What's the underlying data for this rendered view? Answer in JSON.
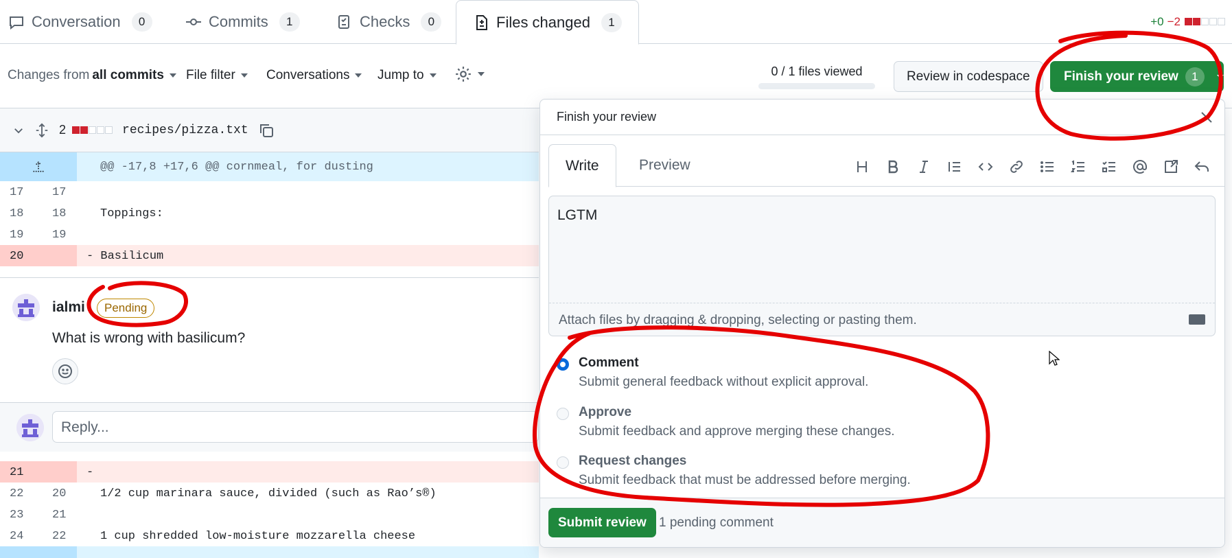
{
  "tabs": [
    {
      "label": "Conversation",
      "count": "0"
    },
    {
      "label": "Commits",
      "count": "1"
    },
    {
      "label": "Checks",
      "count": "0"
    },
    {
      "label": "Files changed",
      "count": "1"
    }
  ],
  "diffstat": {
    "additions": "+0",
    "deletions": "−2"
  },
  "toolbar": {
    "changes_from_prefix": "Changes from",
    "changes_from_value": "all commits",
    "file_filter": "File filter",
    "conversations": "Conversations",
    "jump_to": "Jump to",
    "files_viewed": "0 / 1 files viewed",
    "review_codespace": "Review in codespace",
    "finish_review": "Finish your review",
    "finish_count": "1"
  },
  "file": {
    "changes_count": "2",
    "path": "recipes/pizza.txt",
    "hunk": "@@ -17,8 +17,6 @@ cornmeal, for dusting"
  },
  "lines_top": [
    {
      "old": "17",
      "new": "17",
      "code": ""
    },
    {
      "old": "18",
      "new": "18",
      "code": "Toppings:"
    },
    {
      "old": "19",
      "new": "19",
      "code": ""
    },
    {
      "old": "20",
      "new": "",
      "code": "- Basilicum",
      "type": "del"
    }
  ],
  "comment": {
    "author": "ialmi",
    "badge": "Pending",
    "text": "What is wrong with basilicum?",
    "reply_placeholder": "Reply..."
  },
  "lines_bottom": [
    {
      "old": "21",
      "new": "",
      "code": "-",
      "type": "del"
    },
    {
      "old": "22",
      "new": "20",
      "code": "1/2 cup marinara sauce, divided (such as Rao’s®)"
    },
    {
      "old": "23",
      "new": "21",
      "code": ""
    },
    {
      "old": "24",
      "new": "22",
      "code": "1 cup shredded low-moisture mozzarella cheese"
    }
  ],
  "panel": {
    "title": "Finish your review",
    "tab_write": "Write",
    "tab_preview": "Preview",
    "body": "LGTM",
    "attach": "Attach files by dragging & dropping, selecting or pasting them.",
    "options": [
      {
        "title": "Comment",
        "desc": "Submit general feedback without explicit approval.",
        "selected": true
      },
      {
        "title": "Approve",
        "desc": "Submit feedback and approve merging these changes.",
        "selected": false
      },
      {
        "title": "Request changes",
        "desc": "Submit feedback that must be addressed before merging.",
        "selected": false
      }
    ],
    "submit": "Submit review",
    "pending": "1 pending comment"
  },
  "colors": {
    "primary_green": "#1f883d",
    "annotation_red": "#e50000",
    "link_blue": "#0969da"
  }
}
